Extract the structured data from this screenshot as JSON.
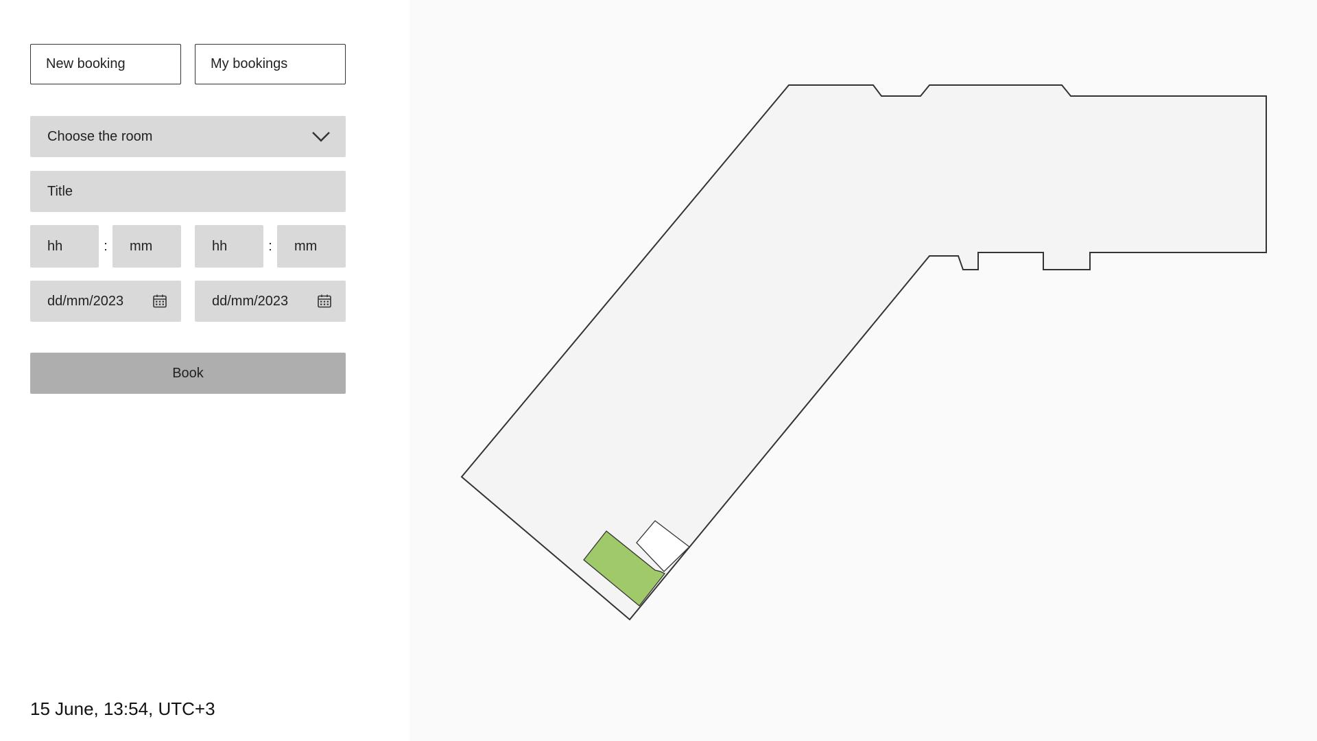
{
  "tabs": {
    "new_booking": "New booking",
    "my_bookings": "My bookings"
  },
  "form": {
    "room_placeholder": "Choose the room",
    "title_placeholder": "Title",
    "start_time": {
      "hours_placeholder": "hh",
      "minutes_placeholder": "mm"
    },
    "end_time": {
      "hours_placeholder": "hh",
      "minutes_placeholder": "mm"
    },
    "time_separator": ":",
    "start_date_placeholder": "dd/mm/2023",
    "end_date_placeholder": "dd/mm/2023",
    "book_label": "Book"
  },
  "footer": {
    "datetime": "15 June, 13:54, UTC+3"
  },
  "icons": {
    "room_select": "chevron-down-icon",
    "date": "calendar-icon"
  },
  "colors": {
    "field_bg": "#d9d9d9",
    "book_button_bg": "#aeaeae",
    "map_bg": "#fafafa",
    "floor_fill": "#f4f4f4",
    "room_selected": "#a0c96a",
    "room_available": "#ffffff"
  }
}
